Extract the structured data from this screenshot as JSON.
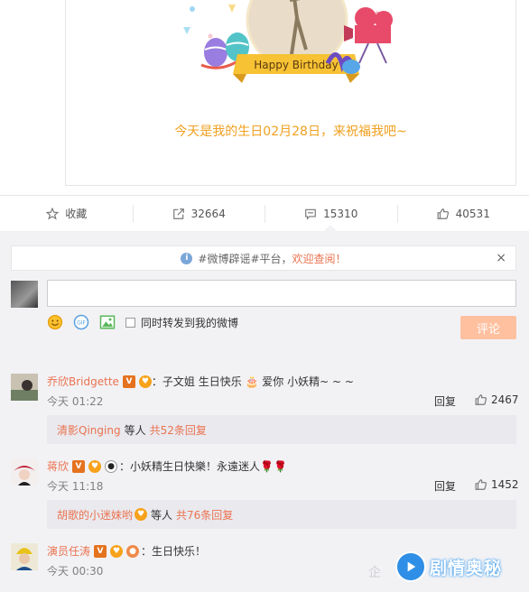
{
  "card": {
    "banner_text": "Happy Birthday",
    "message": "今天是我的生日02月28日，来祝福我吧~"
  },
  "actions": [
    {
      "icon": "star-icon",
      "label": "收藏"
    },
    {
      "icon": "share-icon",
      "label": "32664"
    },
    {
      "icon": "comment-icon",
      "label": "15310"
    },
    {
      "icon": "thumbs-up-icon",
      "label": "40531"
    }
  ],
  "notice": {
    "icon": "info-icon",
    "text": "#微博辟谣#平台，",
    "link": "欢迎查阅！",
    "close": "×"
  },
  "composer": {
    "input_value": "",
    "tools": [
      "emoji-icon",
      "gif-icon",
      "image-icon"
    ],
    "repost_label": "同时转发到我的微博",
    "submit_label": "评论"
  },
  "comments": [
    {
      "user": "乔欣Bridgette",
      "text": "：子文姐 生日快乐 🎂 爱你 小妖精~ ~ ~",
      "time": "今天 01:22",
      "reply": "回复",
      "likes": "2467",
      "sub_user": "清影Qinging",
      "sub_mid": "等人",
      "sub_count": "共52条回复"
    },
    {
      "user": "蒋欣",
      "text": "：小妖精生日快樂！永遠迷人🌹🌹",
      "time": "今天 11:18",
      "reply": "回复",
      "likes": "1452",
      "sub_user": "胡歌的小迷妹哟",
      "sub_mid": "等人",
      "sub_count": "共76条回复"
    },
    {
      "user": "演员任涛",
      "text": "：生日快乐！",
      "time": "今天 00:30",
      "reply": "",
      "likes": "",
      "sub_user": "",
      "sub_mid": "",
      "sub_count": ""
    }
  ],
  "watermark": {
    "brand": "剧情奥秘",
    "prefix": "企"
  },
  "colors": {
    "accent_orange": "#eb7350",
    "birthday_text": "#f0a020",
    "submit_disabled": "#ffc09f",
    "comment_bg": "#f2f2f5"
  }
}
